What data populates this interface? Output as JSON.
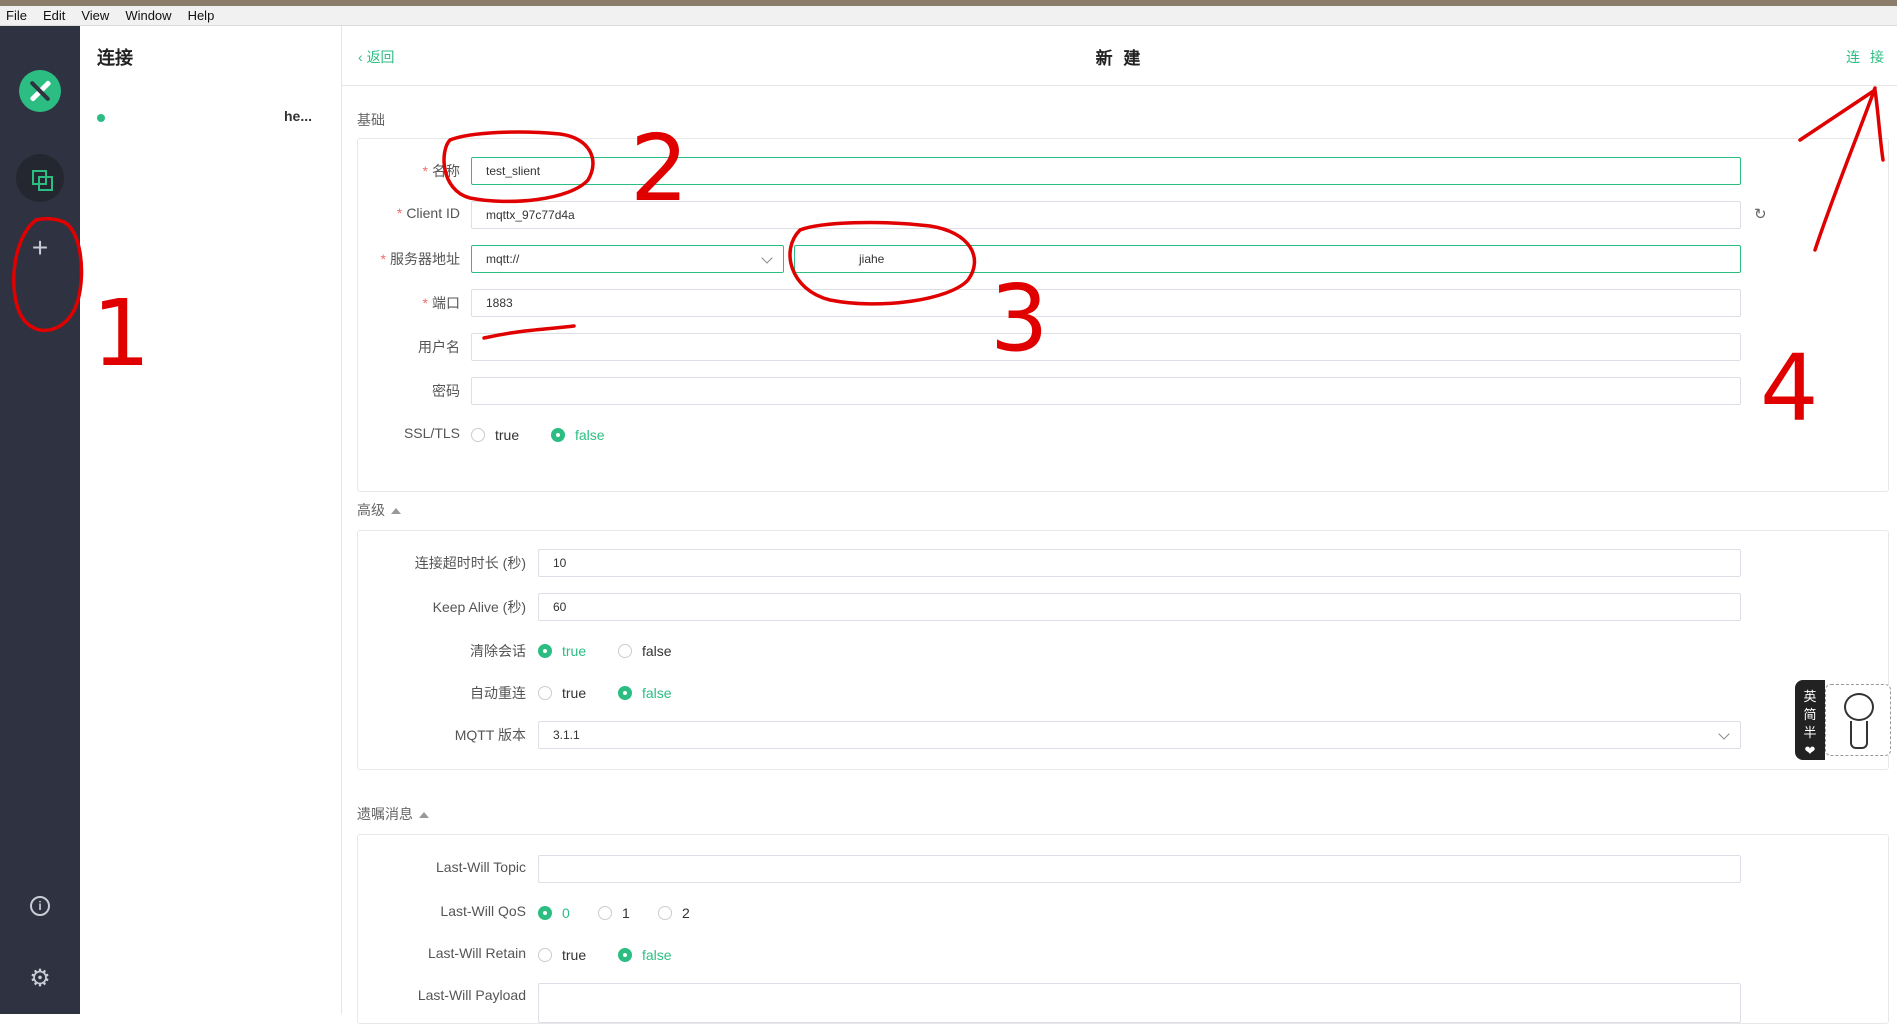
{
  "menubar": [
    "File",
    "Edit",
    "View",
    "Window",
    "Help"
  ],
  "sidebar_list": {
    "title": "连接",
    "items": [
      {
        "name": "he..."
      }
    ]
  },
  "header": {
    "back": "返回",
    "title": "新 建",
    "connect": "连 接"
  },
  "basic": {
    "section": "基础",
    "name_label": "名称",
    "name_value": "test_slient",
    "client_id_label": "Client ID",
    "client_id_value": "mqttx_97c77d4a",
    "server_label": "服务器地址",
    "protocol_value": "mqtt://",
    "host_value": "jiahe",
    "port_label": "端口",
    "port_value": "1883",
    "username_label": "用户名",
    "username_value": "",
    "password_label": "密码",
    "password_value": "",
    "ssl_label": "SSL/TLS",
    "ssl_options": [
      "true",
      "false"
    ],
    "ssl_selected": "false"
  },
  "advanced": {
    "section": "高级",
    "timeout_label": "连接超时时长 (秒)",
    "timeout_value": "10",
    "keepalive_label": "Keep Alive (秒)",
    "keepalive_value": "60",
    "clean_label": "清除会话",
    "clean_options": [
      "true",
      "false"
    ],
    "clean_selected": "true",
    "reconnect_label": "自动重连",
    "reconnect_options": [
      "true",
      "false"
    ],
    "reconnect_selected": "false",
    "version_label": "MQTT 版本",
    "version_value": "3.1.1"
  },
  "will": {
    "section": "遗嘱消息",
    "topic_label": "Last-Will Topic",
    "topic_value": "",
    "qos_label": "Last-Will QoS",
    "qos_options": [
      "0",
      "1",
      "2"
    ],
    "qos_selected": "0",
    "retain_label": "Last-Will Retain",
    "retain_options": [
      "true",
      "false"
    ],
    "retain_selected": "false",
    "payload_label": "Last-Will Payload",
    "payload_value": ""
  },
  "sticker": {
    "chars": [
      "英",
      "简",
      "半",
      "❤"
    ]
  },
  "annotations": [
    "1",
    "2",
    "3",
    "4"
  ],
  "colors": {
    "accent": "#2cbd83",
    "rail": "#2f3240",
    "required": "#f56c6c",
    "annotation": "#e00000"
  },
  "icons": {
    "logo": "mqttx-logo-icon",
    "connections": "connections-icon",
    "add": "plus-icon",
    "info": "info-icon",
    "settings": "gear-icon",
    "refresh": "refresh-icon",
    "back": "chevron-left-icon"
  }
}
